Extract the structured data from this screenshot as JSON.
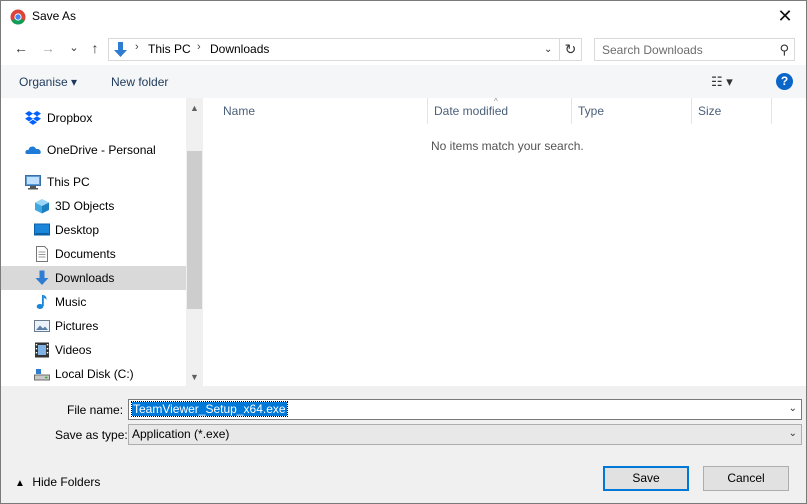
{
  "window": {
    "title": "Save As",
    "close_glyph": "✕"
  },
  "nav": {
    "back_glyph": "←",
    "forward_glyph": "→",
    "recent_glyph": "⌄",
    "up_glyph": "↑",
    "breadcrumbs": [
      "This PC",
      "Downloads"
    ],
    "crumb_sep": "›",
    "dropdown_glyph": "⌄",
    "refresh_glyph": "↻",
    "search_placeholder": "Search Downloads",
    "search_glyph": "⚲"
  },
  "toolbar": {
    "organise_label": "Organise ▾",
    "new_folder_label": "New folder",
    "view_glyph": "☷ ▾",
    "help_glyph": "?"
  },
  "sidebar": {
    "items": [
      {
        "label": "Dropbox",
        "icon": "dropbox-icon"
      },
      {
        "label": "OneDrive - Personal",
        "icon": "onedrive-icon"
      },
      {
        "label": "This PC",
        "icon": "computer-icon"
      },
      {
        "label": "3D Objects",
        "icon": "cube-icon"
      },
      {
        "label": "Desktop",
        "icon": "desktop-icon"
      },
      {
        "label": "Documents",
        "icon": "documents-icon"
      },
      {
        "label": "Downloads",
        "icon": "downloads-icon",
        "selected": true
      },
      {
        "label": "Music",
        "icon": "music-icon"
      },
      {
        "label": "Pictures",
        "icon": "pictures-icon"
      },
      {
        "label": "Videos",
        "icon": "videos-icon"
      },
      {
        "label": "Local Disk (C:)",
        "icon": "drive-icon"
      }
    ],
    "scroll_up_glyph": "▲",
    "scroll_down_glyph": "▼"
  },
  "filelist": {
    "columns": [
      "Name",
      "Date modified",
      "Type",
      "Size"
    ],
    "sort_caret": "^",
    "empty_message": "No items match your search."
  },
  "form": {
    "file_name_label": "File name:",
    "file_name_value": "TeamViewer_Setup_x64.exe",
    "save_type_label": "Save as type:",
    "save_type_value": "Application (*.exe)",
    "caret_glyph": "⌄"
  },
  "footer": {
    "hide_folders_label": "Hide Folders",
    "hide_folders_glyph": "▲",
    "save_label": "Save",
    "cancel_label": "Cancel"
  },
  "colors": {
    "accent": "#0078d7",
    "selection": "#d9d9d9",
    "help": "#0a66c8"
  }
}
